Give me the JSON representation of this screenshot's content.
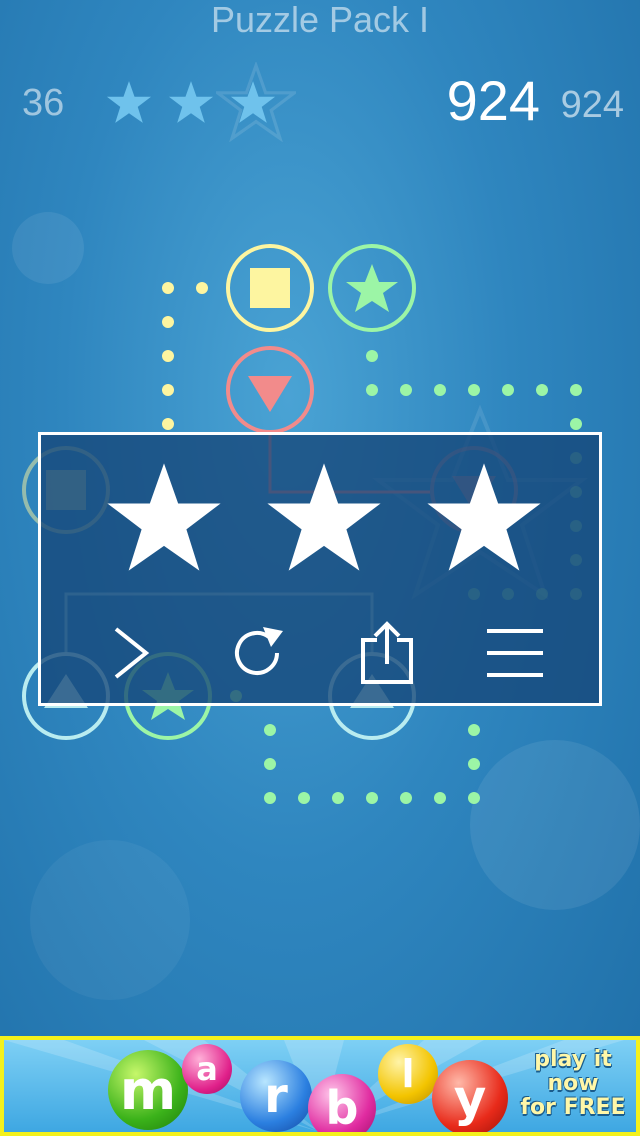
{
  "header": {
    "title": "Puzzle Pack I",
    "level_number": "36",
    "stars_earned": 3,
    "score": "924",
    "best_score": "924"
  },
  "dialog": {
    "stars_earned": 3,
    "actions": [
      {
        "name": "next",
        "icon": "chevron-right-icon"
      },
      {
        "name": "replay",
        "icon": "replay-icon"
      },
      {
        "name": "share",
        "icon": "share-icon"
      },
      {
        "name": "menu",
        "icon": "menu-icon"
      }
    ]
  },
  "ad": {
    "brand": "marbly",
    "cta_line1": "play it",
    "cta_line2": "now",
    "cta_line3": "for FREE"
  },
  "colors": {
    "yellow": "#fdf5a0",
    "green": "#9cf5a6",
    "red": "#f28b8b",
    "cyan": "#b9ecf0",
    "star_blue": "#6fc2ec"
  }
}
